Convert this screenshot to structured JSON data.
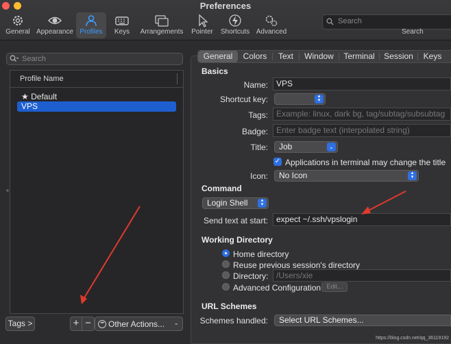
{
  "window": {
    "title": "Preferences"
  },
  "colors": {
    "accent": "#3b9cff",
    "selection": "#1e5fd0",
    "annotation_arrow": "#e03a2e"
  },
  "toolbar": {
    "items": [
      {
        "label": "General",
        "icon": "gear-icon"
      },
      {
        "label": "Appearance",
        "icon": "eye-icon"
      },
      {
        "label": "Profiles",
        "icon": "person-icon",
        "active": true
      },
      {
        "label": "Keys",
        "icon": "keyboard-icon"
      },
      {
        "label": "Arrangements",
        "icon": "windows-icon"
      },
      {
        "label": "Pointer",
        "icon": "cursor-icon"
      },
      {
        "label": "Shortcuts",
        "icon": "lightning-icon"
      },
      {
        "label": "Advanced",
        "icon": "gears-icon"
      }
    ],
    "search_placeholder": "Search",
    "search_caption": "Search"
  },
  "profiles": {
    "search_placeholder": "Search",
    "header": "Profile Name",
    "items": [
      {
        "label": "Default",
        "star": "★"
      },
      {
        "label": "VPS",
        "selected": true
      }
    ],
    "tags_button": "Tags >",
    "add_button": "+",
    "remove_button": "−",
    "other_actions": "Other Actions..."
  },
  "tabs": [
    "General",
    "Colors",
    "Text",
    "Window",
    "Terminal",
    "Session",
    "Keys"
  ],
  "general": {
    "basics_title": "Basics",
    "name_label": "Name:",
    "name_value": "VPS",
    "shortcut_label": "Shortcut key:",
    "tags_label": "Tags:",
    "tags_placeholder": "Example: linux, dark bg, tag/subtag/subsubtag",
    "badge_label": "Badge:",
    "badge_placeholder": "Enter badge text (interpolated string)",
    "title_label": "Title:",
    "title_value": "Job",
    "apps_change_title": "Applications in terminal may change the title",
    "icon_label": "Icon:",
    "icon_value": "No Icon",
    "command_title": "Command",
    "command_mode": "Login Shell",
    "send_text_label": "Send text at start:",
    "send_text_value": "expect  ~/.ssh/vpslogin",
    "working_dir_title": "Working Directory",
    "wd_options": [
      "Home directory",
      "Reuse previous session's directory",
      "Directory:",
      "Advanced Configuration"
    ],
    "wd_selected": 0,
    "directory_placeholder": "/Users/xie",
    "edit_button": "Edit...",
    "url_title": "URL Schemes",
    "schemes_label": "Schemes handled:",
    "schemes_value": "Select URL Schemes..."
  },
  "watermark": "https://blog.csdn.net/qq_36119192"
}
